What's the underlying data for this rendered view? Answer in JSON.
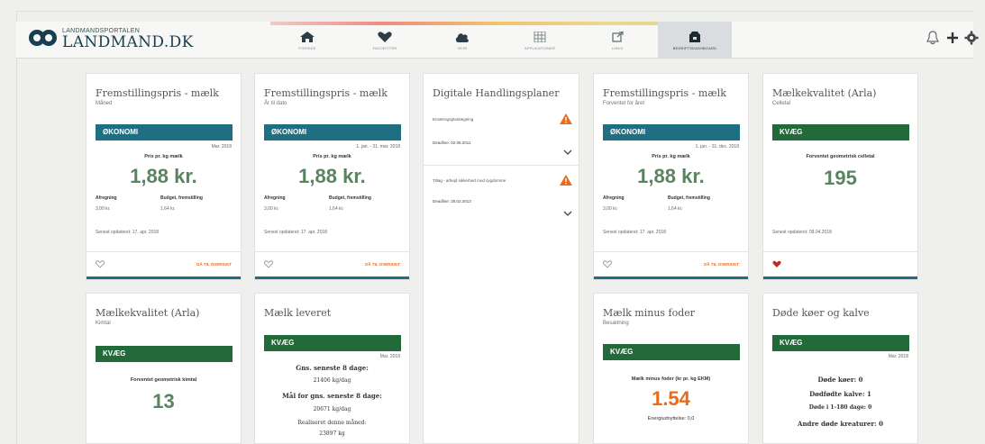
{
  "header": {
    "logo_sub": "LANDMANDSPORTALEN",
    "logo_main": "LANDMAND.DK",
    "tabs": [
      {
        "label": "FORSIDE",
        "icon": "home-icon"
      },
      {
        "label": "FAVORITTER",
        "icon": "heart-icon"
      },
      {
        "label": "VEJR",
        "icon": "cloud-icon"
      },
      {
        "label": "APPLIKATIONER",
        "icon": "grid-icon"
      },
      {
        "label": "LINKS",
        "icon": "external-link-icon"
      },
      {
        "label": "BEDRIFTSDASHBOARD",
        "icon": "dashboard-icon"
      }
    ],
    "active_tab": 5,
    "right_icons": [
      "bell-icon",
      "plus-icon",
      "gear-icon"
    ]
  },
  "cards": {
    "c1": {
      "title": "Fremstillingspris - mælk",
      "subtitle": "Måned",
      "band": "ØKONOMI",
      "period": "Mar. 2018",
      "metric_label": "Pris pr. kg mælk",
      "value": "1,88 kr.",
      "left_label": "Afregning",
      "left_value": "3,00 kr.",
      "right_label": "Budget, fremstilling",
      "right_value": "1,64 kr.",
      "updated": "Senest opdateret: 17. apr. 2018",
      "link": "GÅ TIL OVERSIGT"
    },
    "c2": {
      "title": "Fremstillingspris - mælk",
      "subtitle": "År til dato",
      "band": "ØKONOMI",
      "period": "1. jan. - 31. mar. 2018",
      "metric_label": "Pris pr. kg mælk",
      "value": "1,88 kr.",
      "left_label": "Afregning",
      "left_value": "3,00 kr.",
      "right_label": "Budget, fremstilling",
      "right_value": "1,64 kr.",
      "updated": "Senest opdateret: 17. apr. 2018",
      "link": "GÅ TIL OVERSIGT"
    },
    "plans": {
      "title": "Digitale Handlingsplaner",
      "items": [
        {
          "label": "Ernæringsplanlægning",
          "deadline": "Deadline: 02.06.2011"
        },
        {
          "label": "Tiltag - arbejd sikkerhed mod sygdomme",
          "deadline": "Deadline: 28.02.2013"
        }
      ]
    },
    "c4": {
      "title": "Fremstillingspris - mælk",
      "subtitle": "Forventet for året",
      "band": "ØKONOMI",
      "period": "1. jan. - 31. dec. 2018",
      "metric_label": "Pris pr. kg mælk",
      "value": "1,88 kr.",
      "left_label": "Afregning",
      "left_value": "3,00 kr.",
      "right_label": "Budget, fremstilling",
      "right_value": "1,64 kr.",
      "updated": "Senest opdateret: 17. apr. 2018",
      "link": "GÅ TIL OVERSIGT"
    },
    "c5": {
      "title": "Mælkekvalitet (Arla)",
      "subtitle": "Celletal",
      "band": "KVÆG",
      "metric_label": "Forventet geometrisk celletal",
      "value": "195",
      "updated": "Senest opdateret: 09.04.2018"
    },
    "c6": {
      "title": "Mælkekvalitet (Arla)",
      "subtitle": "Kimtal",
      "band": "KVÆG",
      "metric_label": "Forventet geometrisk kimtal",
      "value": "13"
    },
    "c7": {
      "title": "Mælk leveret",
      "band": "KVÆG",
      "period": "Mar. 2018",
      "lines": [
        "Gns. seneste 8 dage:",
        "21406 kg/dag",
        "Mål for gns. seneste 8 dage:",
        "20671 kg/dag",
        "Realiseret denne måned:",
        "23897 kg"
      ]
    },
    "c8": {
      "title": "Mælk minus foder",
      "subtitle": "Besætning",
      "band": "KVÆG",
      "metric_label": "Mælk minus foder (kr pr. kg EKM)",
      "value": "1.54",
      "extra": "Energiudnyttelse: 0,0"
    },
    "c9": {
      "title": "Døde køer og kalve",
      "band": "KVÆG",
      "period": "Mar. 2018",
      "lines": [
        "Døde køer: 0",
        "Dødfødte kalve: 1",
        "Døde i 1-180 dage: 0",
        "Andre døde kreaturer: 0"
      ]
    }
  },
  "colors": {
    "econ_band": "#1f6f82",
    "cattle_band": "#236a3b",
    "accent_orange": "#e86b1f",
    "value_green": "#5a8460"
  }
}
